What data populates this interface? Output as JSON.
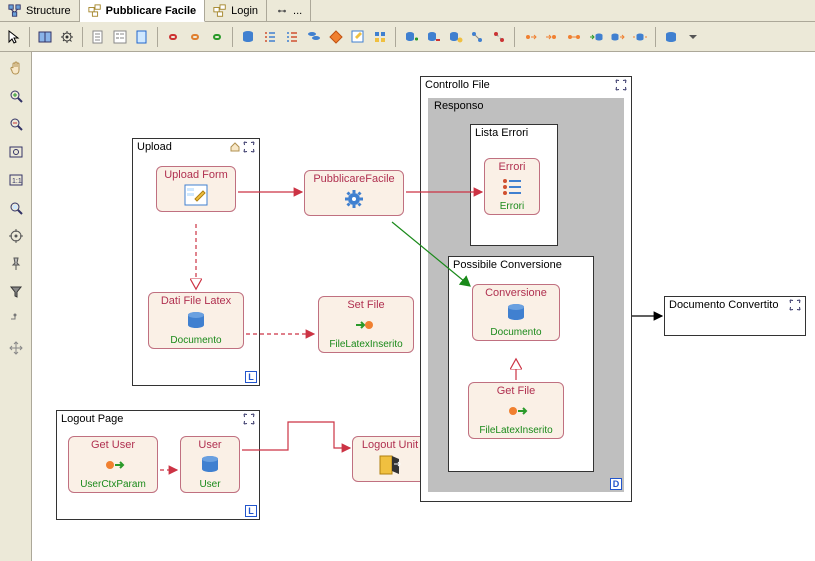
{
  "tabs": {
    "structure": "Structure",
    "pubblicare": "Pubblicare Facile",
    "login": "Login",
    "more": "..."
  },
  "pages": {
    "upload": {
      "title": "Upload"
    },
    "logout": {
      "title": "Logout Page"
    },
    "controllo": {
      "title": "Controllo File"
    },
    "responso": {
      "title": "Responso"
    },
    "listaErrori": {
      "title": "Lista Errori"
    },
    "possibileConv": {
      "title": "Possibile Conversione"
    },
    "docConv": {
      "title": "Documento Convertito"
    }
  },
  "units": {
    "uploadForm": {
      "title": "Upload Form"
    },
    "datiFileLatex": {
      "title": "Dati File Latex",
      "sub": "Documento"
    },
    "pubblicareFacile": {
      "title": "PubblicareFacile"
    },
    "setFile": {
      "title": "Set File",
      "sub": "FileLatexInserito"
    },
    "getUser": {
      "title": "Get User",
      "sub": "UserCtxParam"
    },
    "user": {
      "title": "User",
      "sub": "User"
    },
    "logoutUnit": {
      "title": "Logout Unit"
    },
    "errori": {
      "title": "Errori",
      "sub": "Errori"
    },
    "conversione": {
      "title": "Conversione",
      "sub": "Documento"
    },
    "getFile": {
      "title": "Get File",
      "sub": "FileLatexInserito"
    }
  },
  "badges": {
    "L": "L",
    "D": "D"
  }
}
